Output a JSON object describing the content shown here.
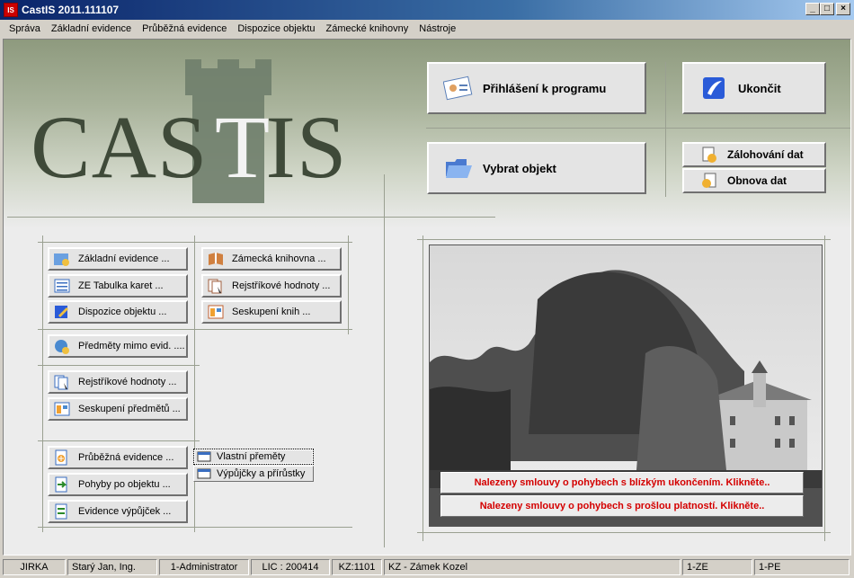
{
  "window": {
    "title": "CastIS 2011.111107",
    "app_icon": "IS"
  },
  "menu": [
    "Správa",
    "Základní evidence",
    "Průběžná evidence",
    "Dispozice objektu",
    "Zámecké knihovny",
    "Nástroje"
  ],
  "logo": {
    "text": "CAS",
    "text_end": "IS",
    "t": "T"
  },
  "buttons": {
    "login": "Přihlášení k programu",
    "exit": "Ukončit",
    "select_object": "Vybrat objekt",
    "backup": "Zálohování dat",
    "restore": "Obnova dat"
  },
  "groups": {
    "basic": [
      "Základní evidence ...",
      "ZE Tabulka karet ...",
      "Dispozice objektu ..."
    ],
    "library": [
      "Zámecká knihovna ...",
      "Rejstříkové hodnoty ...",
      "Seskupení knih ..."
    ],
    "other": "Předměty mimo evid. ....",
    "registry": [
      "Rejstříkové hodnoty ...",
      "Seskupení předmětů ..."
    ],
    "ongoing": [
      "Průběžná evidence ...",
      "Pohyby po objektu ...",
      "Evidence výpůjček ..."
    ],
    "ongoing_sub": [
      "Vlastní přeměty",
      "Výpůjčky a přírůstky"
    ]
  },
  "alerts": [
    "Nalezeny smlouvy o pohybech s blízkým ukončením. Klikněte..",
    "Nalezeny smlouvy o pohybech s prošlou platností. Klikněte.."
  ],
  "status": [
    "JIRKA",
    "Starý Jan, Ing.",
    "1-Administrator",
    "LIC : 200414",
    "KZ:1101",
    "KZ - Zámek Kozel",
    "1-ZE",
    "1-PE"
  ],
  "colors": {
    "alert": "#d40000",
    "header": "#8e9a7e",
    "logo": "#3f4a39"
  }
}
